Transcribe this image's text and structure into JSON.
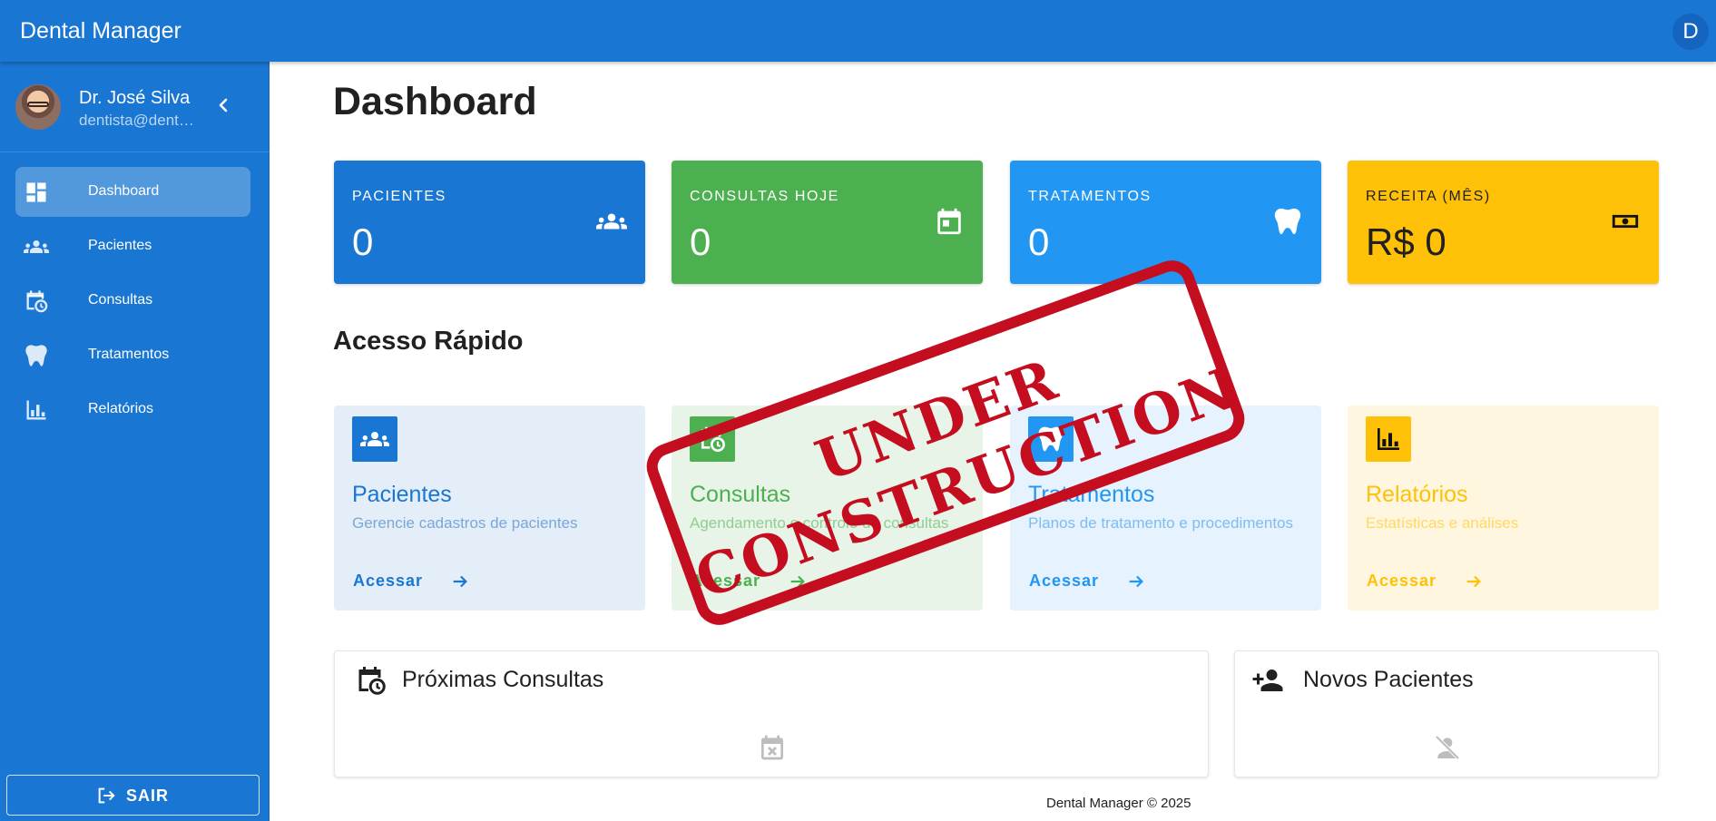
{
  "app": {
    "title": "Dental Manager",
    "user_initial": "D"
  },
  "sidebar": {
    "profile": {
      "name": "Dr. José Silva",
      "email": "dentista@dentalmanager.com"
    },
    "items": [
      {
        "label": "Dashboard",
        "icon": "dashboard-icon",
        "active": true
      },
      {
        "label": "Pacientes",
        "icon": "people-icon",
        "active": false
      },
      {
        "label": "Consultas",
        "icon": "calendar-clock-icon",
        "active": false
      },
      {
        "label": "Tratamentos",
        "icon": "tooth-icon",
        "active": false
      },
      {
        "label": "Relatórios",
        "icon": "bar-chart-icon",
        "active": false
      }
    ],
    "logout_label": "SAIR"
  },
  "main": {
    "title": "Dashboard",
    "stats": [
      {
        "label": "PACIENTES",
        "value": "0",
        "color": "#1976d2",
        "icon": "people-icon"
      },
      {
        "label": "CONSULTAS HOJE",
        "value": "0",
        "color": "#4caf50",
        "icon": "calendar-today-icon"
      },
      {
        "label": "TRATAMENTOS",
        "value": "0",
        "color": "#2196f3",
        "icon": "tooth-icon"
      },
      {
        "label": "RECEITA (MÊS)",
        "value": "R$ 0",
        "color": "#ffc107",
        "icon": "money-icon"
      }
    ],
    "quick_access_title": "Acesso Rápido",
    "quick_access": [
      {
        "title": "Pacientes",
        "description": "Gerencie cadastros de pacientes",
        "link": "Acessar",
        "color": "#1976d2",
        "icon": "people-icon"
      },
      {
        "title": "Consultas",
        "description": "Agendamento e controle de consultas",
        "link": "Acessar",
        "color": "#4caf50",
        "icon": "calendar-clock-icon"
      },
      {
        "title": "Tratamentos",
        "description": "Planos de tratamento e procedimentos",
        "link": "Acessar",
        "color": "#2196f3",
        "icon": "tooth-icon"
      },
      {
        "title": "Relatórios",
        "description": "Estatísticas e análises",
        "link": "Acessar",
        "color": "#ffc107",
        "icon": "bar-chart-icon"
      }
    ],
    "panels": {
      "upcoming": {
        "title": "Próximas Consultas",
        "icon": "calendar-clock-icon",
        "empty_icon": "calendar-remove-icon"
      },
      "new_patients": {
        "title": "Novos Pacientes",
        "icon": "person-add-icon",
        "empty_icon": "person-off-icon"
      }
    }
  },
  "stamp": {
    "line1": "UNDER",
    "line2": "CONSTRUCTION"
  },
  "footer": {
    "text": "Dental Manager © 2025"
  }
}
